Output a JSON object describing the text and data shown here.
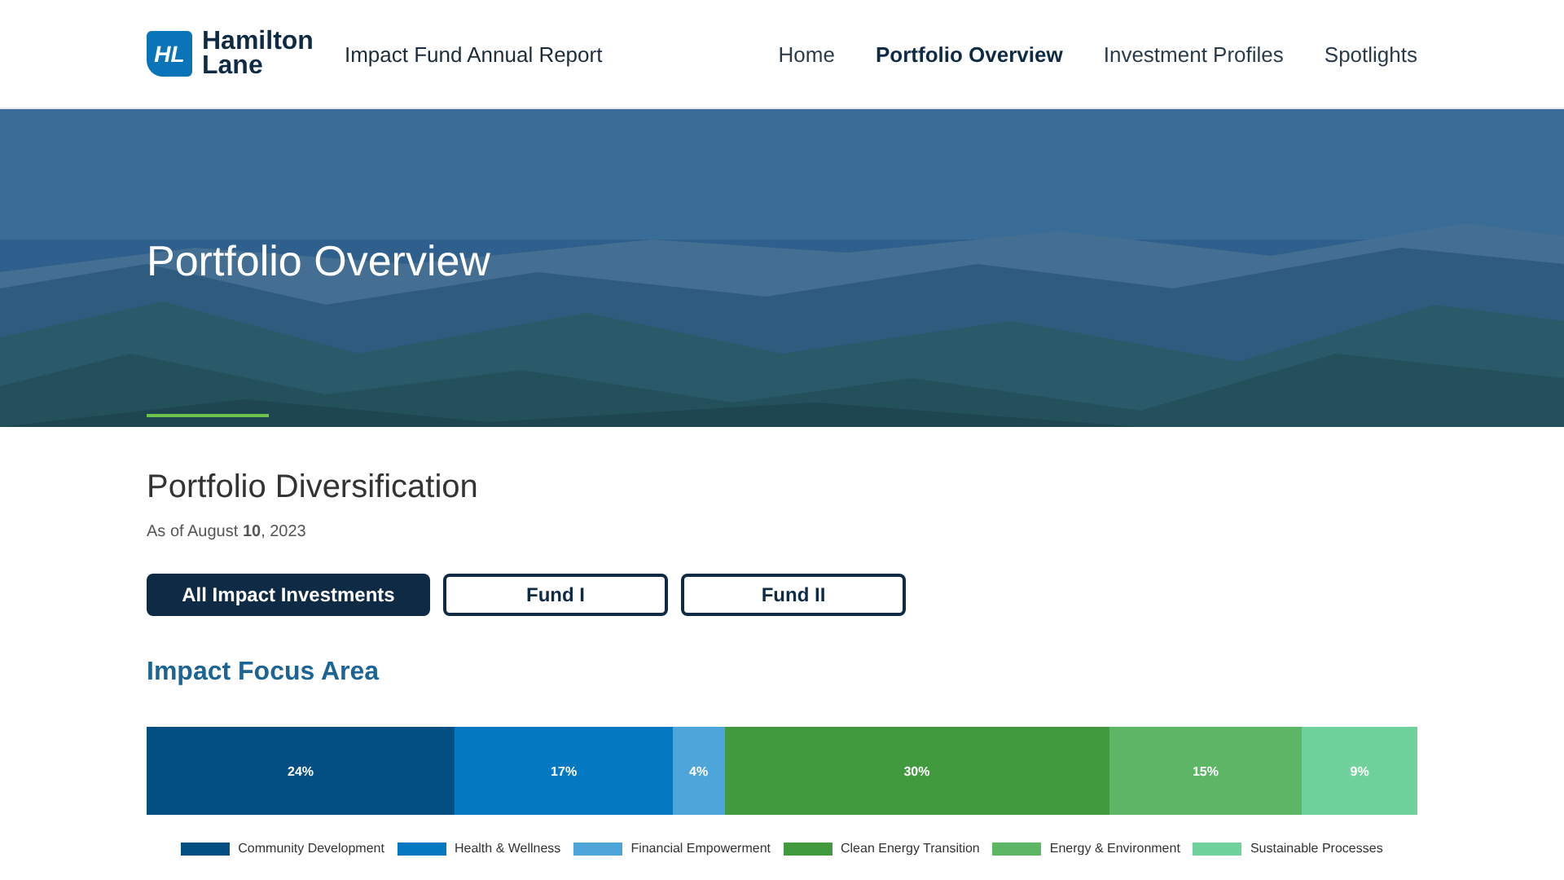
{
  "header": {
    "logo": {
      "mark": "HL",
      "line1": "Hamilton",
      "line2": "Lane"
    },
    "report_title": "Impact Fund Annual Report",
    "nav": [
      {
        "label": "Home",
        "selected": false
      },
      {
        "label": "Portfolio Overview",
        "selected": true
      },
      {
        "label": "Investment Profiles",
        "selected": false
      },
      {
        "label": "Spotlights",
        "selected": false
      }
    ]
  },
  "hero": {
    "kind": "picture",
    "title": "Portfolio Overview"
  },
  "section": {
    "title": "Portfolio Diversification",
    "date": "As of August **10**, 2023",
    "filters": [
      {
        "label": "All Impact Investments",
        "selected": true
      },
      {
        "label": "Fund I",
        "selected": false
      },
      {
        "label": "Fund II",
        "selected": false
      }
    ],
    "subtitle": "Impact Focus Area",
    "chart_data": {
      "type": "bar",
      "orientation": "horizontal",
      "stacked": true,
      "legend": "bottom",
      "series": [
        {
          "name": "Community Development",
          "color": "#034f84",
          "values": [
            24
          ],
          "value_labels": [
            "24%"
          ]
        },
        {
          "name": "Health & Wellness",
          "color": "#0479c2",
          "values": [
            17
          ],
          "value_labels": [
            "17%"
          ]
        },
        {
          "name": "Financial Empowerment",
          "color": "#4ea5d9",
          "values": [
            4
          ],
          "value_labels": [
            "4%"
          ]
        },
        {
          "name": "Clean Energy Transition",
          "color": "#429a3e",
          "values": [
            30
          ],
          "value_labels": [
            "30%"
          ]
        },
        {
          "name": "Energy & Environment",
          "color": "#5db665",
          "values": [
            15
          ],
          "value_labels": [
            "15%"
          ]
        },
        {
          "name": "Sustainable Processes",
          "color": "#6fd19b",
          "values": [
            9
          ],
          "value_labels": [
            "9%"
          ]
        }
      ]
    }
  }
}
